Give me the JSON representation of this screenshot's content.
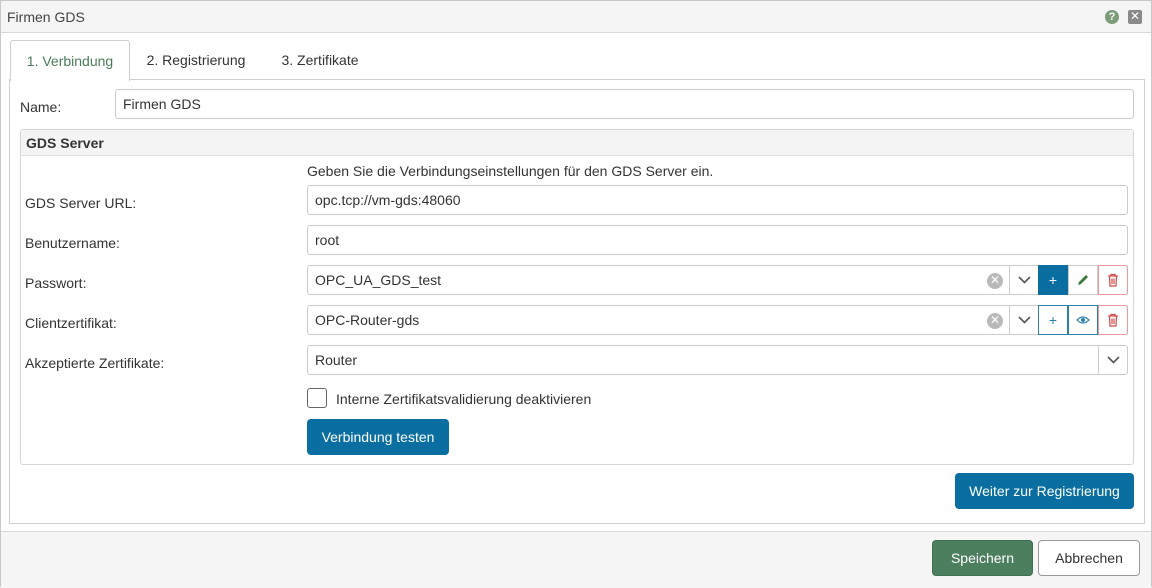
{
  "window": {
    "title": "Firmen GDS",
    "help_icon": "?",
    "close_icon": "✕"
  },
  "tabs": [
    {
      "label": "1. Verbindung",
      "active": true
    },
    {
      "label": "2. Registrierung",
      "active": false
    },
    {
      "label": "3. Zertifikate",
      "active": false
    }
  ],
  "name": {
    "label": "Name:",
    "value": "Firmen GDS"
  },
  "gds": {
    "title": "GDS Server",
    "hint": "Geben Sie die Verbindungseinstellungen für den GDS Server ein.",
    "url": {
      "label": "GDS Server URL:",
      "value": "opc.tcp://vm-gds:48060"
    },
    "user": {
      "label": "Benutzername:",
      "value": "root"
    },
    "password": {
      "label": "Passwort:",
      "value": "OPC_UA_GDS_test",
      "add_symbol": "+"
    },
    "client_cert": {
      "label": "Clientzertifikat:",
      "value": "OPC-Router-gds",
      "add_symbol": "+"
    },
    "accepted": {
      "label": "Akzeptierte Zertifikate:",
      "value": "Router"
    },
    "disable_validation": {
      "label": "Interne Zertifikatsvalidierung deaktivieren",
      "checked": false
    },
    "test_button": "Verbindung testen"
  },
  "next_button": "Weiter zur Registrierung",
  "footer": {
    "save": "Speichern",
    "cancel": "Abbrechen"
  },
  "colors": {
    "primary_blue": "#0a6fa0",
    "save_green": "#4c7f5e",
    "active_tab_text": "#4a7c59",
    "delete_red": "#d04a4a"
  }
}
